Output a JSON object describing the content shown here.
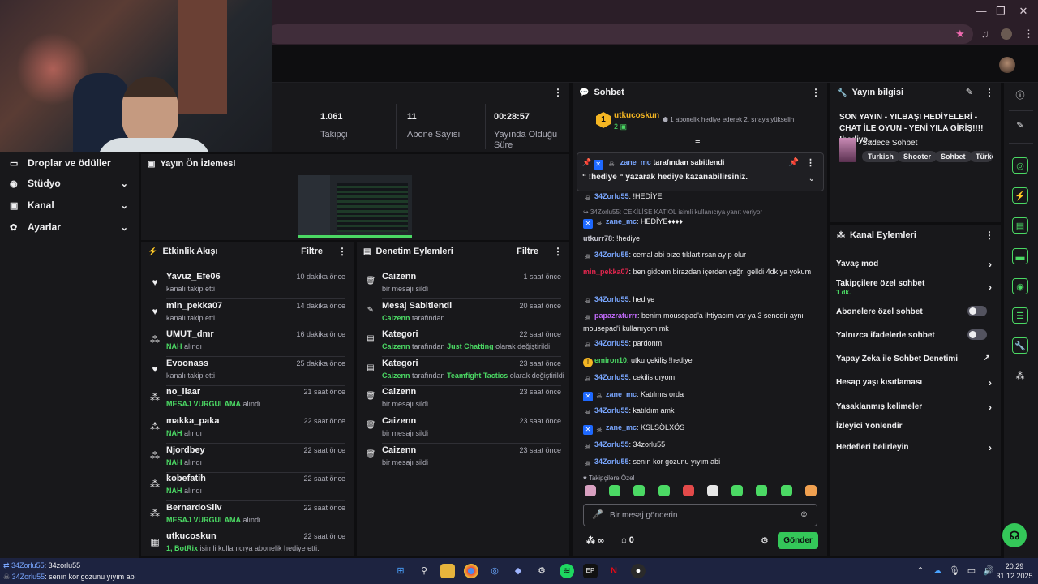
{
  "stats": [
    {
      "value": "1.061",
      "label": "Takipçi"
    },
    {
      "value": "11",
      "label": "Abone Sayısı"
    },
    {
      "value": "00:28:57",
      "label": "Yayında Olduğu Süre"
    }
  ],
  "nav": [
    {
      "label": "Droplar ve ödüller",
      "icon": "gift-icon",
      "glyph": "▭"
    },
    {
      "label": "Stüdyo",
      "icon": "studio-icon",
      "glyph": "◉"
    },
    {
      "label": "Kanal",
      "icon": "channel-icon",
      "glyph": "▣"
    },
    {
      "label": "Ayarlar",
      "icon": "settings-icon",
      "glyph": "✿"
    }
  ],
  "preview": {
    "title": "Yayın Ön İzlemesi"
  },
  "activity": {
    "title": "Etkinlik Akışı",
    "filter": "Filtre",
    "items": [
      {
        "icon": "heart-icon",
        "glyph": "♥",
        "name": "Yavuz_Efe06",
        "pre": "",
        "hl": "",
        "post": "kanalı takip etti",
        "time": "10 dakika önce"
      },
      {
        "icon": "heart-icon",
        "glyph": "♥",
        "name": "min_pekka07",
        "pre": "",
        "hl": "",
        "post": "kanalı takip etti",
        "time": "14 dakika önce"
      },
      {
        "icon": "points-icon",
        "glyph": "⁂",
        "name": "UMUT_dmr",
        "pre": "",
        "hl": "NAH",
        "post": " alındı",
        "time": "16 dakika önce"
      },
      {
        "icon": "heart-icon",
        "glyph": "♥",
        "name": "Evoonass",
        "pre": "",
        "hl": "",
        "post": "kanalı takip etti",
        "time": "25 dakika önce"
      },
      {
        "icon": "points-icon",
        "glyph": "⁂",
        "name": "no_liaar",
        "pre": "",
        "hl": "MESAJ VURGULAMA",
        "post": " alındı",
        "time": "21 saat önce"
      },
      {
        "icon": "points-icon",
        "glyph": "⁂",
        "name": "makka_paka",
        "pre": "",
        "hl": "NAH",
        "post": " alındı",
        "time": "22 saat önce"
      },
      {
        "icon": "points-icon",
        "glyph": "⁂",
        "name": "Njordbey",
        "pre": "",
        "hl": "NAH",
        "post": " alındı",
        "time": "22 saat önce"
      },
      {
        "icon": "points-icon",
        "glyph": "⁂",
        "name": "kobefatih",
        "pre": "",
        "hl": "NAH",
        "post": " alındı",
        "time": "22 saat önce"
      },
      {
        "icon": "points-icon",
        "glyph": "⁂",
        "name": "BernardoSilv",
        "pre": "",
        "hl": "MESAJ VURGULAMA",
        "post": " alındı",
        "time": "22 saat önce"
      },
      {
        "icon": "gift-sub-icon",
        "glyph": "▦",
        "name": "utkucoskun",
        "pre": "1, ",
        "hl": "BotRix",
        "post": " isimli kullanıcıya abonelik hediye etti.",
        "time": "22 saat önce"
      }
    ]
  },
  "modactions": {
    "title": "Denetim Eylemleri",
    "filter": "Filtre",
    "items": [
      {
        "icon": "trash-icon",
        "glyph": "🗑",
        "name": "Caizenn",
        "pre": "",
        "hl": "",
        "mid": "",
        "hl2": "",
        "post": "bir mesajı sildi",
        "time": "1 saat önce"
      },
      {
        "icon": "pin-icon",
        "glyph": "✎",
        "name": "Mesaj Sabitlendi",
        "pre": "",
        "hl": "Caizenn",
        "mid": " tarafından",
        "hl2": "",
        "post": "",
        "time": "20 saat önce"
      },
      {
        "icon": "category-icon",
        "glyph": "▤",
        "name": "Kategori",
        "pre": "",
        "hl": "Caizenn",
        "mid": " tarafından ",
        "hl2": "Just Chatting",
        "post": " olarak değiştirildi",
        "time": "22 saat önce"
      },
      {
        "icon": "category-icon",
        "glyph": "▤",
        "name": "Kategori",
        "pre": "",
        "hl": "Caizenn",
        "mid": " tarafından ",
        "hl2": "Teamfight Tactics",
        "post": " olarak değiştirildi",
        "time": "23 saat önce"
      },
      {
        "icon": "trash-icon",
        "glyph": "🗑",
        "name": "Caizenn",
        "pre": "",
        "hl": "",
        "mid": "",
        "hl2": "",
        "post": "bir mesajı sildi",
        "time": "23 saat önce"
      },
      {
        "icon": "trash-icon",
        "glyph": "🗑",
        "name": "Caizenn",
        "pre": "",
        "hl": "",
        "mid": "",
        "hl2": "",
        "post": "bir mesajı sildi",
        "time": "23 saat önce"
      },
      {
        "icon": "trash-icon",
        "glyph": "🗑",
        "name": "Caizenn",
        "pre": "",
        "hl": "",
        "mid": "",
        "hl2": "",
        "post": "bir mesajı sildi",
        "time": "23 saat önce"
      }
    ]
  },
  "chat": {
    "title": "Sohbet",
    "leader": {
      "rank": "1",
      "name": "utkucoskun",
      "count": "2",
      "notice": "1 abonelik hediye ederek 2. sıraya yükselin"
    },
    "pinned": {
      "by": "zane_mc",
      "by_suffix": "tarafından sabitlendi",
      "text": "“ !hediye “ yazarak hediye kazanabilirsiniz."
    },
    "messages": [
      {
        "badge": "grey",
        "user": "34Zorlu55",
        "color": "#7aa7ff",
        "text": "!HEDİYE",
        "reply": ""
      },
      {
        "badge": "",
        "user": "",
        "color": "",
        "text": "",
        "reply": "↪ 34Zorlu55: CEKİLİSE KATIOL isimli kullanıcıya yanıt veriyor"
      },
      {
        "badge": "blue",
        "user": "zane_mc",
        "color": "#7aa7ff",
        "text": "HEDİYE♦♦♦♦",
        "reply": ""
      },
      {
        "badge": "",
        "user": "utkurr78",
        "color": "#c7c7d1",
        "text": "!hediye",
        "reply": ""
      },
      {
        "badge": "grey",
        "user": "34Zorlu55",
        "color": "#7aa7ff",
        "text": "cemal abi bıze tıklartırsan ayıp olur",
        "reply": ""
      },
      {
        "badge": "",
        "user": "min_pekka07",
        "color": "#e3264e",
        "text": "ben gidcem birazdan içerden çağrı gelldi 4dk ya yokum",
        "reply": ""
      },
      {
        "badge": "grey",
        "user": "34Zorlu55",
        "color": "#7aa7ff",
        "text": "hediye",
        "reply": ""
      },
      {
        "badge": "grey",
        "user": "papazraturrr",
        "color": "#c56bff",
        "text": "benim mousepad'a ihtiyacım var ya 3 senedir aynı mousepad'i kullanıyom mk",
        "reply": ""
      },
      {
        "badge": "grey",
        "user": "34Zorlu55",
        "color": "#7aa7ff",
        "text": "pardonm",
        "reply": ""
      },
      {
        "badge": "gold",
        "user": "emiron10",
        "color": "#4bd964",
        "text": "utku çekiliş !hediye",
        "reply": ""
      },
      {
        "badge": "grey",
        "user": "34Zorlu55",
        "color": "#7aa7ff",
        "text": "cekilis dıyom",
        "reply": ""
      },
      {
        "badge": "blue",
        "user": "zane_mc",
        "color": "#7aa7ff",
        "text": "Katılmıs orda",
        "reply": ""
      },
      {
        "badge": "grey",
        "user": "34Zorlu55",
        "color": "#7aa7ff",
        "text": "katıldım amk",
        "reply": ""
      },
      {
        "badge": "blue",
        "user": "zane_mc",
        "color": "#7aa7ff",
        "text": "KSLSÖLXÖS",
        "reply": ""
      },
      {
        "badge": "grey",
        "user": "34Zorlu55",
        "color": "#7aa7ff",
        "text": "34zorlu55",
        "reply": ""
      },
      {
        "badge": "grey",
        "user": "34Zorlu55",
        "color": "#7aa7ff",
        "text": "senın kor gozunu yıyım abi",
        "reply": ""
      }
    ],
    "followers_only": "Takipçilere Özel",
    "input_placeholder": "Bir mesaj gönderin",
    "points": "∞",
    "gifts": "0",
    "send": "Gönder"
  },
  "stream_info": {
    "title": "Yayın bilgisi",
    "stream_title": "SON YAYIN - YILBAŞI HEDİYELERİ - CHAT İLE OYUN - YENİ YILA GİRİŞ!!!! !hediye...",
    "category": "Sadece Sohbet",
    "tags": [
      "Turkish",
      "Shooter",
      "Sohbet",
      "Türkç"
    ]
  },
  "channel_actions": {
    "title": "Kanal Eylemleri",
    "items": [
      {
        "label": "Yavaş mod",
        "sub": "",
        "control": "chevron"
      },
      {
        "label": "Takipçilere özel sohbet",
        "sub": "1 dk.",
        "control": "chevron"
      },
      {
        "label": "Abonelere özel sohbet",
        "sub": "",
        "control": "toggle"
      },
      {
        "label": "Yalnızca ifadelerle sohbet",
        "sub": "",
        "control": "toggle"
      },
      {
        "label": "Yapay Zeka ile Sohbet Denetimi",
        "sub": "",
        "control": "external"
      },
      {
        "label": "Hesap yaşı kısıtlaması",
        "sub": "",
        "control": "chevron"
      },
      {
        "label": "Yasaklanmış kelimeler",
        "sub": "",
        "control": "chevron"
      },
      {
        "label": "İzleyici Yönlendir",
        "sub": "",
        "control": "none"
      },
      {
        "label": "Hedefleri belirleyin",
        "sub": "",
        "control": "chevron"
      }
    ]
  },
  "notification": {
    "line1_user": "34Zorlu55",
    "line1_text": ": 34zorlu55",
    "line2_user": "34Zorlu55",
    "line2_text": ": senın kor gozunu yıyım abi"
  },
  "clock": {
    "time": "20:29",
    "date": "31.12.2025"
  },
  "colors": {
    "accent": "#4bd964",
    "background": "#0e0e10",
    "panel": "#18181b"
  }
}
